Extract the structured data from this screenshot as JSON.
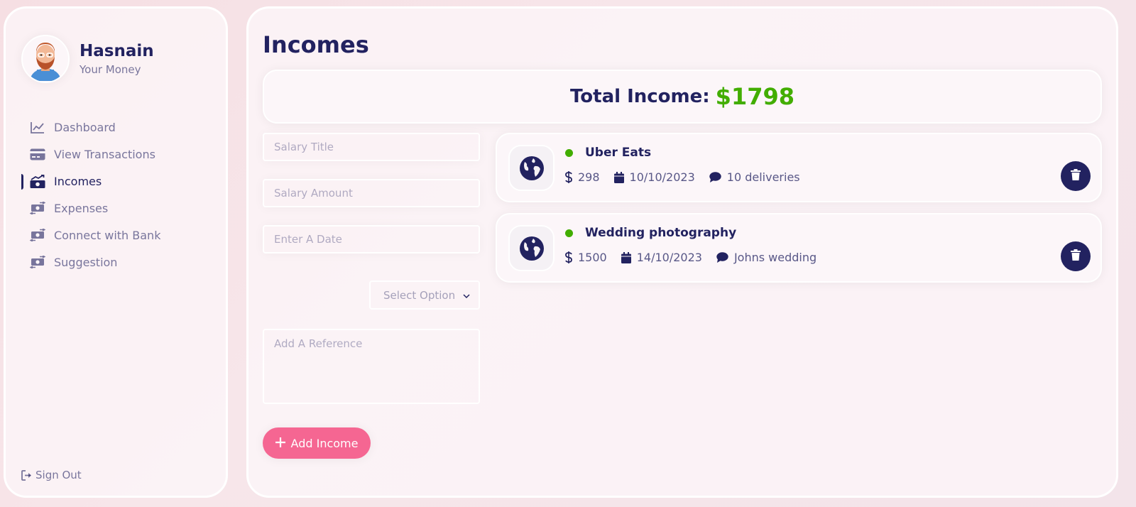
{
  "colors": {
    "primary": "#222260",
    "accent": "#f56692",
    "income_green": "#42ad00"
  },
  "user": {
    "name": "Hasnain",
    "subtitle": "Your Money",
    "avatar_icon": "avatar-man-bearded"
  },
  "nav": [
    {
      "label": "Dashboard",
      "icon": "line-chart-icon",
      "active": false
    },
    {
      "label": "View Transactions",
      "icon": "credit-card-icon",
      "active": false
    },
    {
      "label": "Incomes",
      "icon": "money-trend-icon",
      "active": true
    },
    {
      "label": "Expenses",
      "icon": "money-exchange-icon",
      "active": false
    },
    {
      "label": "Connect with Bank",
      "icon": "money-exchange-icon",
      "active": false
    },
    {
      "label": "Suggestion",
      "icon": "money-exchange-icon",
      "active": false
    }
  ],
  "signout": {
    "label": "Sign Out",
    "icon": "sign-out-icon"
  },
  "page": {
    "title": "Incomes",
    "total_label": "Total Income:",
    "total_amount": "$1798"
  },
  "form": {
    "title_placeholder": "Salary Title",
    "amount_placeholder": "Salary Amount",
    "date_placeholder": "Enter A Date",
    "select_placeholder": "Select Option",
    "reference_placeholder": "Add A Reference",
    "add_button_label": "Add Income"
  },
  "incomes": [
    {
      "title": "Uber Eats",
      "amount": "298",
      "date": "10/10/2023",
      "note": "10 deliveries",
      "icon": "globe-icon"
    },
    {
      "title": "Wedding photography",
      "amount": "1500",
      "date": "14/10/2023",
      "note": "Johns wedding",
      "icon": "globe-icon"
    }
  ]
}
